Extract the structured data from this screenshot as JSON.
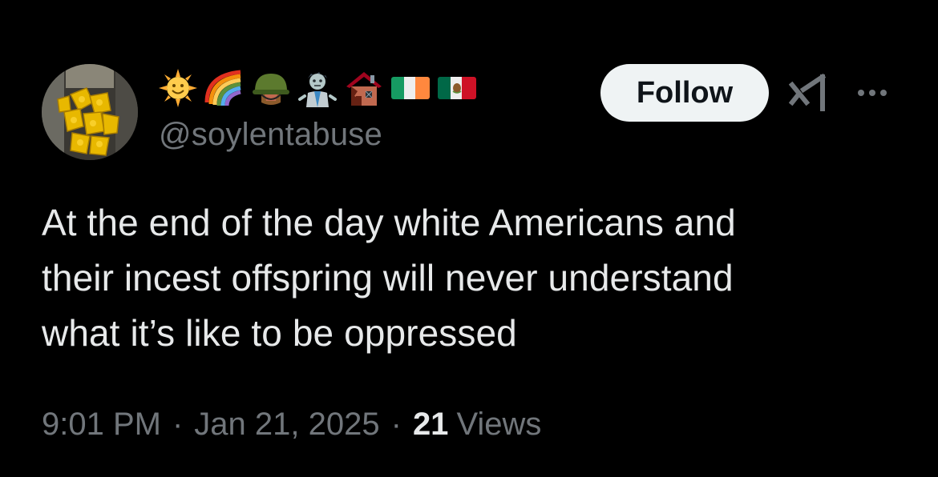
{
  "author": {
    "display_name_emojis": [
      "sun-with-face",
      "rainbow",
      "military-helmet",
      "zombie",
      "derelict-house",
      "flag-ireland",
      "flag-mexico"
    ],
    "handle": "@soylentabuse"
  },
  "actions": {
    "follow_label": "Follow",
    "grok_icon": "grok-icon",
    "more_icon": "more-icon"
  },
  "tweet": {
    "text": "At the end of the day white Americans and\ntheir incest offspring will never understand\nwhat it’s like to be oppressed"
  },
  "meta": {
    "time": "9:01 PM",
    "separator": "·",
    "date": "Jan 21, 2025",
    "views_count": "21",
    "views_label": "Views"
  },
  "colors": {
    "background": "#000000",
    "text_primary": "#e7e9ea",
    "text_secondary": "#71767b",
    "follow_bg": "#eff3f4",
    "follow_text": "#0f1419"
  }
}
